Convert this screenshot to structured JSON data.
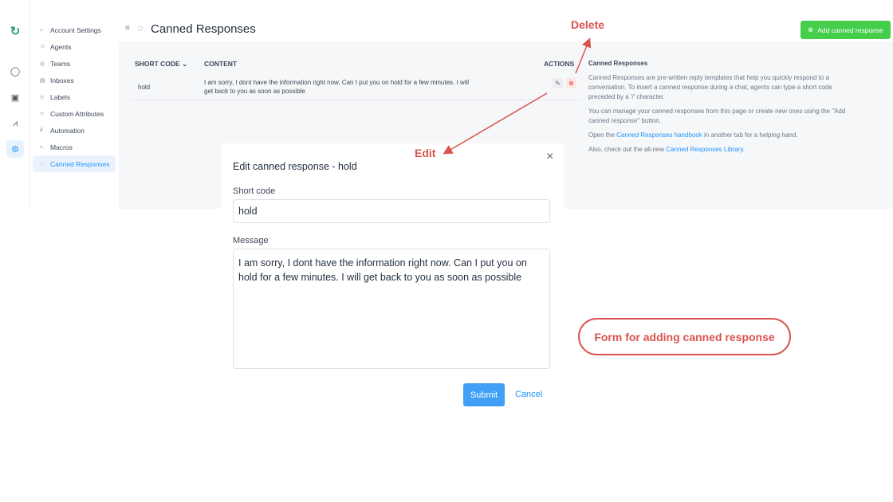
{
  "rail": {
    "icons": [
      "logo",
      "chat-icon",
      "contacts-icon",
      "reports-icon",
      "settings-icon"
    ]
  },
  "sidebar": {
    "items": [
      {
        "label": "Account Settings",
        "icon": "⌂"
      },
      {
        "label": "Agents",
        "icon": "☺"
      },
      {
        "label": "Teams",
        "icon": "◎"
      },
      {
        "label": "Inboxes",
        "icon": "▤"
      },
      {
        "label": "Labels",
        "icon": "◇"
      },
      {
        "label": "Custom Attributes",
        "icon": "‹›"
      },
      {
        "label": "Automation",
        "icon": "∂"
      },
      {
        "label": "Macros",
        "icon": "⤷"
      },
      {
        "label": "Canned Responses",
        "icon": "◌",
        "active": true
      }
    ]
  },
  "header": {
    "title": "Canned Responses",
    "add_button": "Add canned response"
  },
  "table": {
    "columns": [
      "SHORT CODE",
      "CONTENT",
      "ACTIONS"
    ],
    "rows": [
      {
        "short_code": "hold",
        "content_line1": "I am sorry, I dont have the information right now. Can I put you on hold for a few minutes. I will",
        "content_line2": "get back to you as soon as possible"
      }
    ]
  },
  "info": {
    "title": "Canned Responses",
    "p1": "Canned Responses are pre-written reply templates that help you quickly respond to a conversation. To insert a canned response during a chat, agents can type a short code preceded by a '/' character.",
    "p2": "You can manage your canned responses from this page or create new ones using the \"Add canned response\" button.",
    "p3_pre": "Open the ",
    "p3_link": "Canned Responses handbook",
    "p3_post": " in another tab for a helping hand.",
    "p4_pre": "Also, check out the all-new ",
    "p4_link": "Canned Responses Library",
    "p4_post": "."
  },
  "modal": {
    "title": "Edit canned response - hold",
    "short_code_label": "Short code",
    "short_code_value": "hold",
    "message_label": "Message",
    "message_value": "I am sorry, I dont have the information right now. Can I put you on hold for a few minutes. I will get back to you as soon as possible",
    "submit": "Submit",
    "cancel": "Cancel"
  },
  "annotations": {
    "delete": "Delete",
    "edit": "Edit",
    "form": "Form for adding canned response",
    "color": "#d9534f"
  }
}
